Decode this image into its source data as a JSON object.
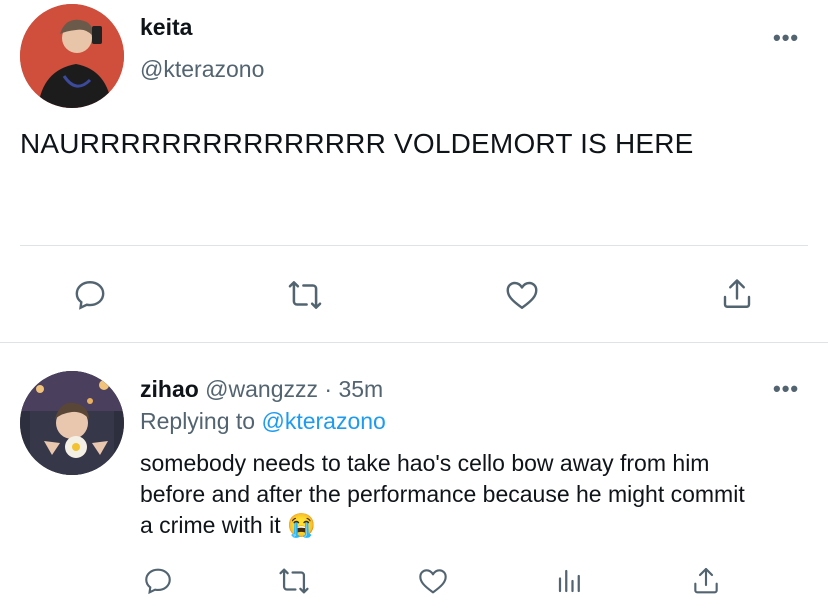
{
  "main_tweet": {
    "author_name": "keita",
    "author_handle": "@kterazono",
    "text": "NAURRRRRRRRRRRRRRR VOLDEMORT IS HERE",
    "more_label": "•••"
  },
  "reply": {
    "author_name": "zihao",
    "author_handle": "@wangzzz",
    "separator": "·",
    "time": "35m",
    "replying_prefix": "Replying to",
    "replying_handle": "@kterazono",
    "text_line1": "somebody needs to take hao's cello bow away from him",
    "text_line2": "before and after the performance because he might commit",
    "text_line3": "a crime with it",
    "emoji": "😭",
    "more_label": "•••"
  },
  "colors": {
    "text": "#0f1419",
    "secondary": "#536471",
    "link": "#1d9bf0",
    "divider": "#dfe3e6"
  },
  "icons": {
    "reply": "speech-bubble-icon",
    "retweet": "retweet-icon",
    "like": "heart-icon",
    "share": "share-icon",
    "analytics": "analytics-icon"
  }
}
